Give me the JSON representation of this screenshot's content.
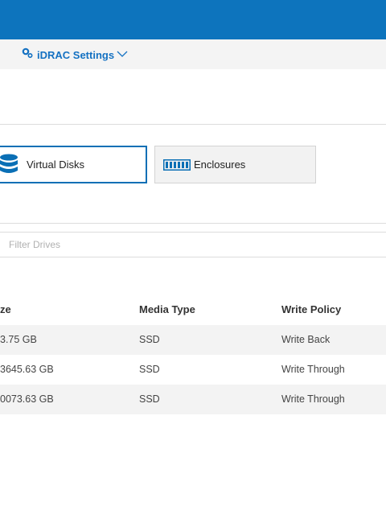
{
  "header": {
    "idrac_settings_label": "iDRAC Settings",
    "gear_icon": "gear-icon",
    "chevron_icon": "chevron-down-icon"
  },
  "tabs": [
    {
      "label": "Virtual Disks",
      "icon": "database-icon",
      "selected": true
    },
    {
      "label": "Enclosures",
      "icon": "enclosure-icon",
      "selected": false
    }
  ],
  "filter": {
    "placeholder": "Filter Drives"
  },
  "table": {
    "columns": [
      "ze",
      "Media Type",
      "Write Policy"
    ],
    "rows": [
      {
        "size": "3.75 GB",
        "media_type": "SSD",
        "write_policy": "Write Back"
      },
      {
        "size": "3645.63 GB",
        "media_type": "SSD",
        "write_policy": "Write Through"
      },
      {
        "size": "0073.63 GB",
        "media_type": "SSD",
        "write_policy": "Write Through"
      }
    ]
  },
  "colors": {
    "topbar": "#0d74bd",
    "accent": "#1471c2",
    "selected_tab_border": "#0a6fb5"
  }
}
